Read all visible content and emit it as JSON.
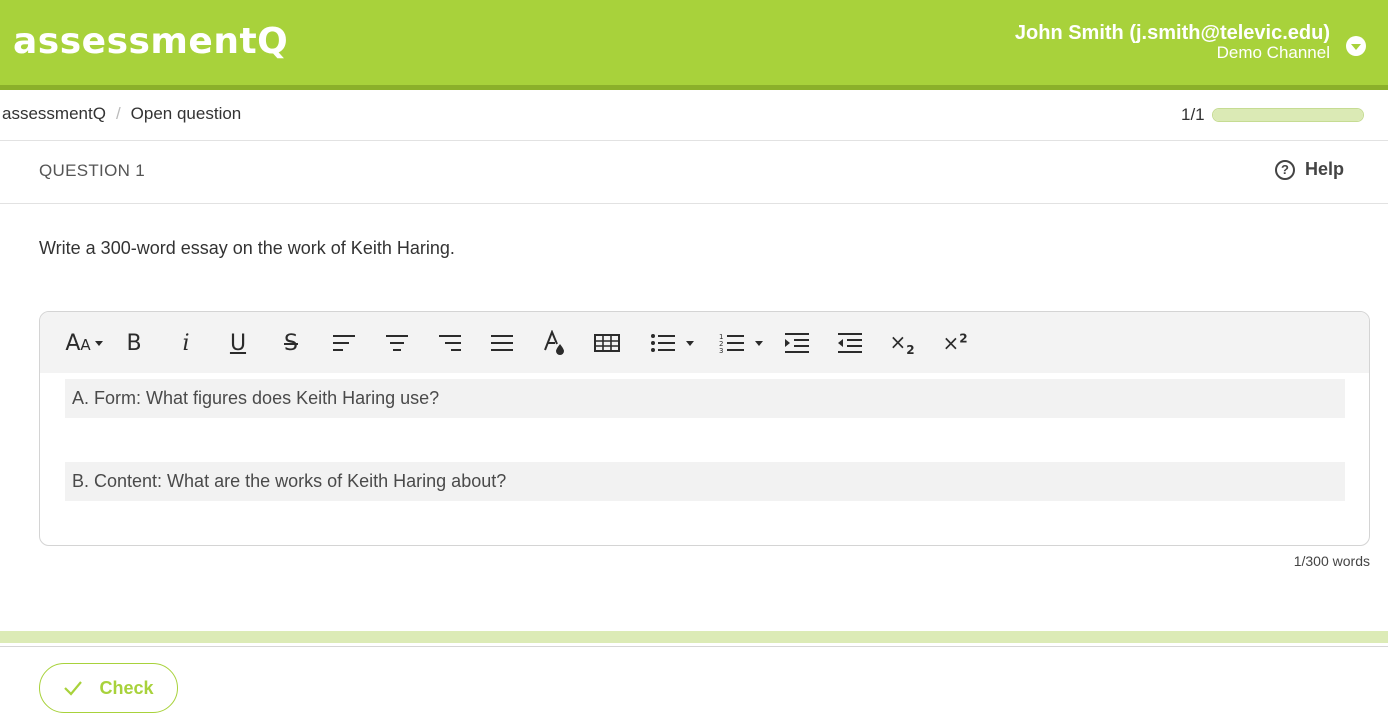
{
  "header": {
    "logo": "assessmentQ",
    "user_name": "John Smith (j.smith@televic.edu)",
    "channel": "Demo Channel",
    "brand_color": "#a8d23b"
  },
  "breadcrumb": {
    "items": [
      "assessmentQ",
      "Open question"
    ],
    "separator": "/"
  },
  "progress": {
    "label": "1/1",
    "value": 1.0
  },
  "question": {
    "label": "QUESTION 1",
    "help_label": "Help",
    "prompt": "Write a 300-word essay on the work of Keith Haring."
  },
  "editor": {
    "toolbar": [
      "font-size-icon",
      "bold-icon",
      "italic-icon",
      "underline-icon",
      "strikethrough-icon",
      "align-left-icon",
      "align-center-icon",
      "align-right-icon",
      "align-justify-icon",
      "text-color-icon",
      "table-icon",
      "bullet-list-icon",
      "numbered-list-icon",
      "indent-icon",
      "outdent-icon",
      "subscript-icon",
      "superscript-icon"
    ],
    "paragraphs": [
      "A. Form: What figures does Keith Haring use?",
      "B. Content: What are the works of Keith Haring about?"
    ],
    "word_count": "1/300 words"
  },
  "footer": {
    "check_label": "Check"
  }
}
